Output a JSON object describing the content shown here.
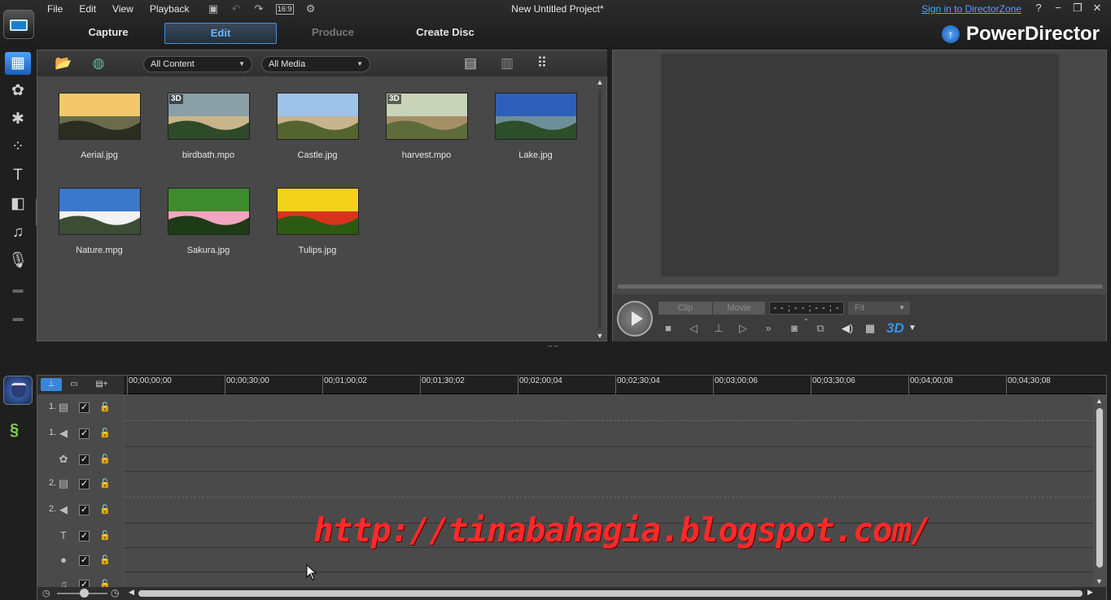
{
  "window": {
    "project_title": "New Untitled Project*",
    "signin_link": "Sign in to DirectorZone",
    "aspect_ratio": "16:9",
    "brand_name": "PowerDirector"
  },
  "menu": [
    "File",
    "Edit",
    "View",
    "Playback"
  ],
  "tabs": [
    {
      "label": "Capture",
      "state": "normal"
    },
    {
      "label": "Edit",
      "state": "active"
    },
    {
      "label": "Produce",
      "state": "disabled"
    },
    {
      "label": "Create Disc",
      "state": "normal"
    }
  ],
  "library": {
    "content_filter": "All Content",
    "media_filter": "All Media",
    "items": [
      {
        "name": "Aerial.jpg",
        "is3d": false,
        "palette": [
          "#f2c86a",
          "#6b6a4d",
          "#2b2d20"
        ]
      },
      {
        "name": "birdbath.mpo",
        "is3d": true,
        "palette": [
          "#8aa0a6",
          "#c9b58a",
          "#2f4a2a"
        ]
      },
      {
        "name": "Castle.jpg",
        "is3d": false,
        "palette": [
          "#9fc3e8",
          "#c7b48e",
          "#55632f"
        ]
      },
      {
        "name": "harvest.mpo",
        "is3d": true,
        "palette": [
          "#c9d3b8",
          "#a59066",
          "#5e6b3a"
        ]
      },
      {
        "name": "Lake.jpg",
        "is3d": false,
        "palette": [
          "#2f5fb8",
          "#6c8f9a",
          "#2e4d2a"
        ]
      },
      {
        "name": "Nature.mpg",
        "is3d": false,
        "palette": [
          "#3a78c9",
          "#f2f2f2",
          "#3d4d35"
        ]
      },
      {
        "name": "Sakura.jpg",
        "is3d": false,
        "palette": [
          "#3e8a2e",
          "#f0a6c0",
          "#1f3a16"
        ]
      },
      {
        "name": "Tulips.jpg",
        "is3d": false,
        "palette": [
          "#f2d21a",
          "#d8341c",
          "#2d5a12"
        ]
      }
    ]
  },
  "preview": {
    "clip_label": "Clip",
    "movie_label": "Movie",
    "timecode": "- - ; - - ; - - ; - -",
    "fit_label": "Fit",
    "three_d_label": "3D"
  },
  "timeline": {
    "ruler_ticks": [
      "00;00;00;00",
      "00;00;30;00",
      "00;01;00;02",
      "00;01;30;02",
      "00;02;00;04",
      "00;02;30;04",
      "00;03;00;06",
      "00;03;30;06",
      "00;04;00;08",
      "00;04;30;08"
    ],
    "tracks": [
      {
        "num": "1.",
        "icon": "video-track-icon",
        "glyph": "▤",
        "checked": true
      },
      {
        "num": "1.",
        "icon": "audio-track-icon",
        "glyph": "◀",
        "checked": true
      },
      {
        "num": "",
        "icon": "effect-track-icon",
        "glyph": "✿",
        "checked": true
      },
      {
        "num": "2.",
        "icon": "video-track-icon",
        "glyph": "▤",
        "checked": true
      },
      {
        "num": "2.",
        "icon": "audio-track-icon",
        "glyph": "◀",
        "checked": true
      },
      {
        "num": "",
        "icon": "title-track-icon",
        "glyph": "T",
        "checked": true
      },
      {
        "num": "",
        "icon": "voice-track-icon",
        "glyph": "●",
        "checked": true
      },
      {
        "num": "",
        "icon": "music-track-icon",
        "glyph": "♫",
        "checked": true
      }
    ]
  },
  "watermark": "http://tinabahagia.blogspot.com/"
}
